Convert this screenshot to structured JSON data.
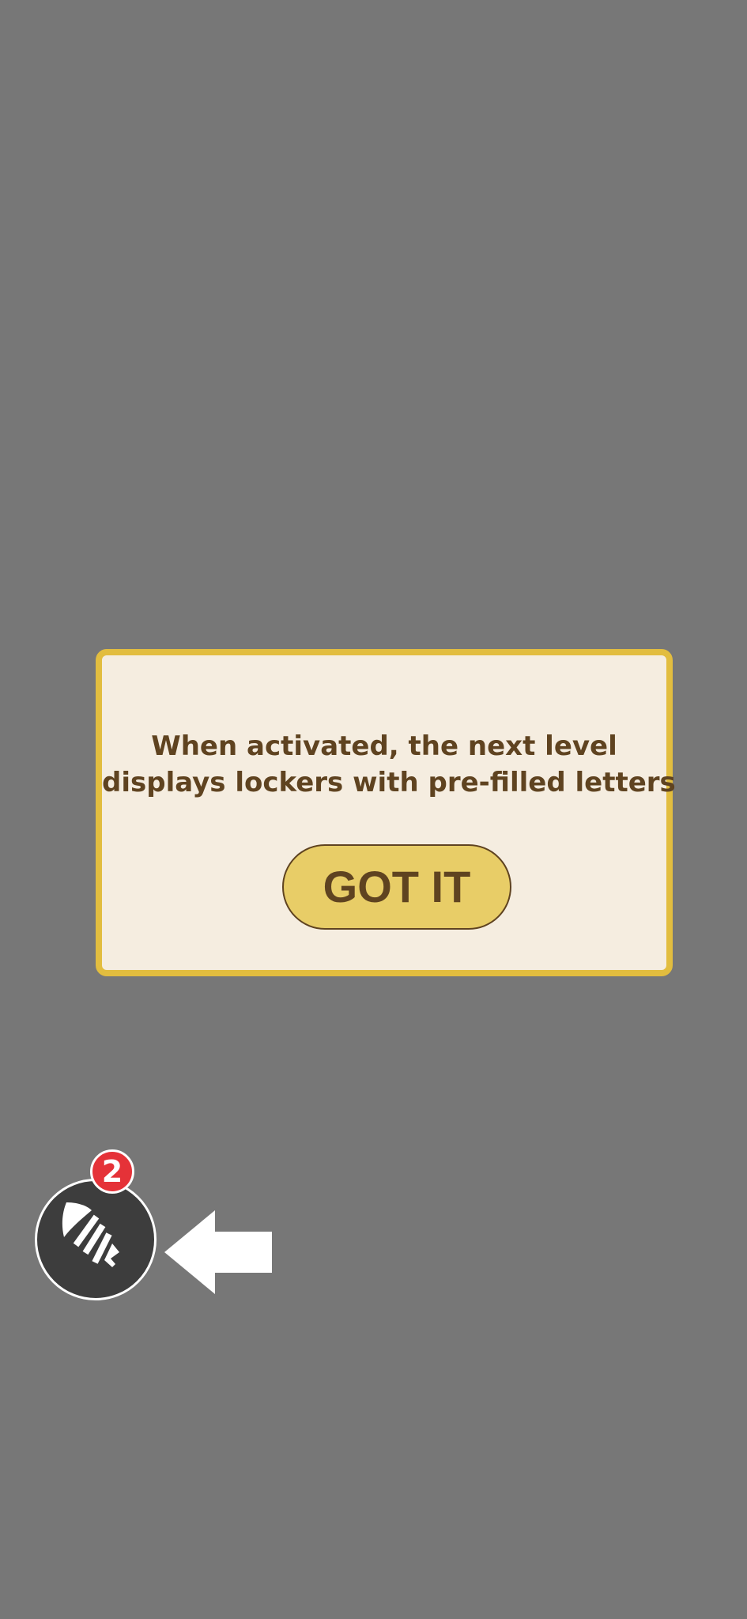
{
  "dialog": {
    "message_lines": [
      "When activated, the next level",
      "displays lockers with pre-filled letters"
    ],
    "confirm_label": "GOT IT"
  },
  "booster": {
    "icon": "rocket-icon",
    "badge_count": "2"
  },
  "hint": {
    "icon": "arrow-left-icon"
  },
  "colors": {
    "backdrop": "#777777",
    "dialog_background": "#f5ede0",
    "dialog_border": "#e2bd3f",
    "text": "#5f4320",
    "button": "#e8cd67",
    "booster_background": "#3d3d3d",
    "badge": "#e53238"
  }
}
